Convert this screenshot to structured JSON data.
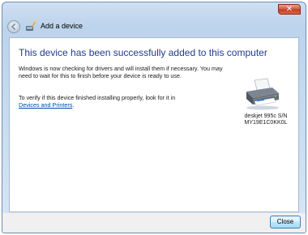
{
  "window": {
    "close_glyph": "✕",
    "title": "Add a device"
  },
  "content": {
    "heading": "This device has been successfully added to this computer",
    "paragraph1": "Windows is now checking for drivers and will install them if necessary. You may need to wait for this to finish before your device is ready to use.",
    "paragraph2_prefix": "To verify if this device finished installing properly, look for it in",
    "paragraph2_link": "Devices and Printers",
    "paragraph2_suffix": ".",
    "device_name": "deskjet 995c S/N",
    "device_serial": "MY19E1C0KK0L"
  },
  "footer": {
    "close_label": "Close"
  },
  "icons": {
    "back": "back-arrow-icon",
    "wizard": "add-device-wizard-icon",
    "printer": "printer-icon"
  },
  "colors": {
    "heading": "#1e3b8f",
    "link": "#0645ad",
    "title_close": "#c33a1f"
  }
}
